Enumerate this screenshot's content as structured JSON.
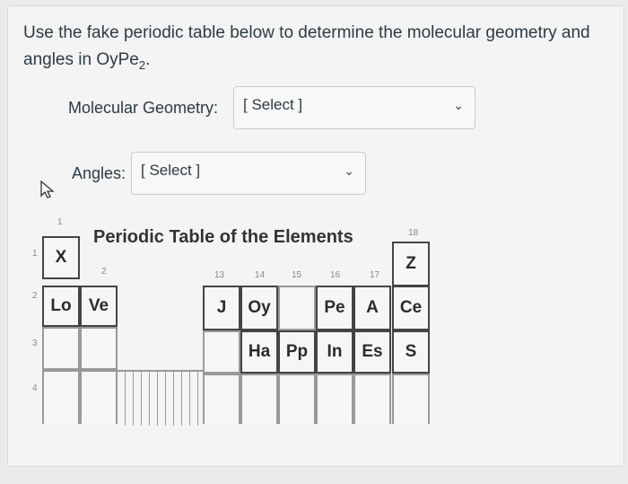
{
  "question": {
    "text_before": "Use the fake periodic table below to determine the molecular geometry and angles in OyPe",
    "subscript": "2",
    "text_after": "."
  },
  "fields": {
    "geometry_label": "Molecular Geometry:",
    "geometry_value": "[ Select ]",
    "angles_label": "Angles:",
    "angles_value": "[ Select ]"
  },
  "periodic_table": {
    "title": "Periodic Table of the Elements",
    "group_numbers": [
      "1",
      "2",
      "13",
      "14",
      "15",
      "16",
      "17",
      "18"
    ],
    "period_numbers": [
      "1",
      "2",
      "3",
      "4"
    ],
    "elements": {
      "X": "X",
      "Z": "Z",
      "Lo": "Lo",
      "Ve": "Ve",
      "J": "J",
      "Oy": "Oy",
      "Pe": "Pe",
      "A": "A",
      "Ce": "Ce",
      "Ha": "Ha",
      "Pp": "Pp",
      "In": "In",
      "Es": "Es",
      "S": "S"
    }
  },
  "icons": {
    "dropdown": "chevron-down-icon",
    "cursor": "mouse-pointer-icon"
  }
}
